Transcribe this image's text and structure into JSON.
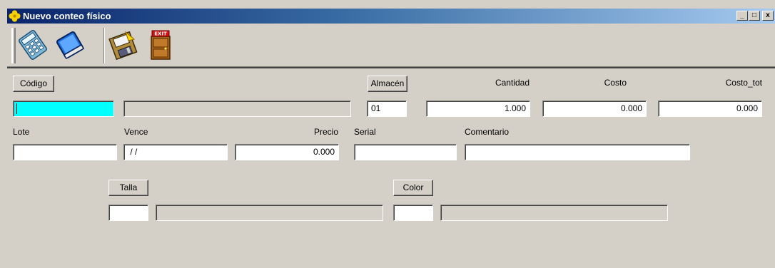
{
  "window": {
    "title": "Nuevo conteo físico",
    "icon": "clover-icon"
  },
  "titlebar_buttons": {
    "minimize": "_",
    "maximize": "□",
    "close": "x"
  },
  "toolbar": {
    "tools": [
      {
        "name": "calculator-icon"
      },
      {
        "name": "book-icon"
      },
      {
        "name": "save-icon"
      },
      {
        "name": "exit-icon",
        "text": "EXIT"
      }
    ]
  },
  "form": {
    "codigo_button": "Código",
    "codigo_value": "",
    "descripcion_value": "",
    "almacen_button": "Almacén",
    "almacen_value": "01",
    "cantidad_label": "Cantidad",
    "cantidad_value": "1.000",
    "costo_label": "Costo",
    "costo_value": "0.000",
    "costo_tot_label": "Costo_tot",
    "costo_tot_value": "0.000",
    "lote_label": "Lote",
    "lote_value": "",
    "vence_label": "Vence",
    "vence_value": " / /",
    "precio_label": "Precio",
    "precio_value": "0.000",
    "serial_label": "Serial",
    "serial_value": "",
    "comentario_label": "Comentario",
    "comentario_value": "",
    "talla_button": "Talla",
    "talla_code_value": "",
    "talla_desc_value": "",
    "color_button": "Color",
    "color_code_value": "",
    "color_desc_value": ""
  },
  "colors": {
    "face": "#d4d0c8",
    "focus": "#00ffff",
    "title_start": "#0a246a",
    "title_end": "#a6caf0"
  }
}
